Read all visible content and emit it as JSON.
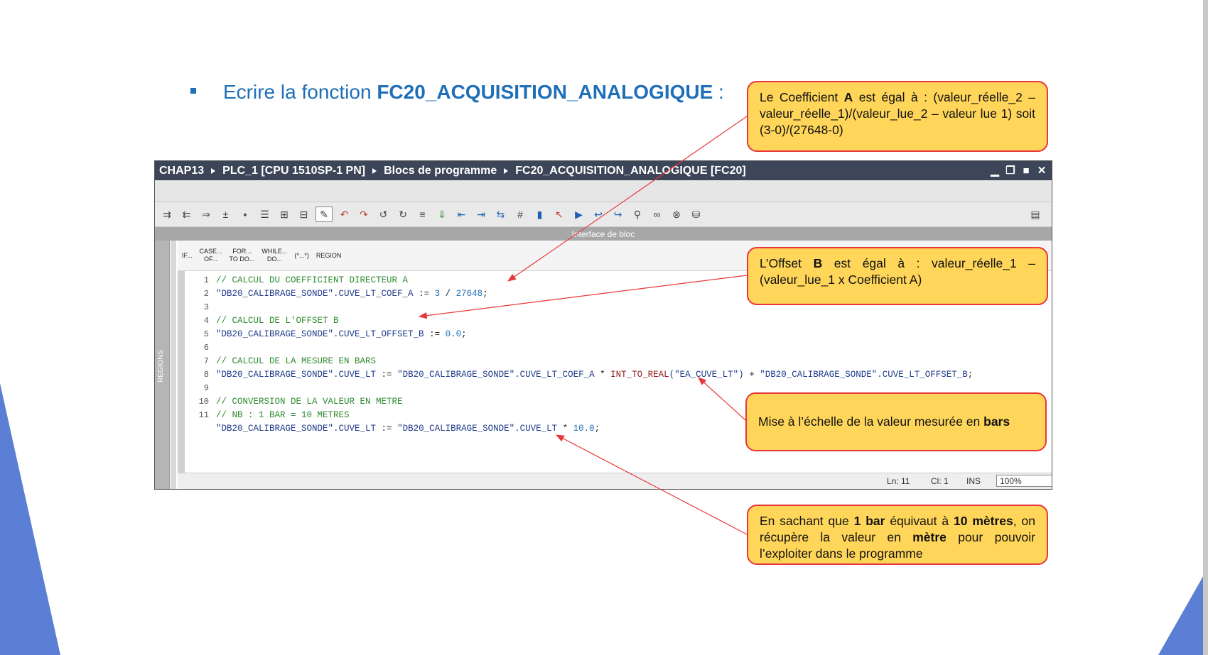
{
  "slide": {
    "title_prefix": "Ecrire la fonction ",
    "title_bold": "FC20_ACQUISITION_ANALOGIQUE",
    "title_suffix": " :"
  },
  "colors": {
    "title_blue": "#1f6fb8",
    "callout_fill": "#ffd65a",
    "callout_border": "#e8373a",
    "titlebar_bg": "#3c4658"
  },
  "window": {
    "breadcrumbs": [
      "CHAP13",
      "PLC_1 [CPU 1510SP-1 PN]",
      "Blocs de programme",
      "FC20_ACQUISITION_ANALOGIQUE [FC20]"
    ],
    "interface_bar": "Interface de bloc",
    "regions_label": "REGIONS",
    "toolbar_icons": [
      "insert-network-icon",
      "delete-network-icon",
      "jump-icon",
      "download-icon",
      "monitor-icon",
      "list-icon",
      "compare-icon",
      "reference-icon",
      "highlight-icon",
      "breakpoint-icon",
      "breakpoint-off-icon",
      "step-icon",
      "step-over-icon",
      "comment-icon",
      "expand-icon",
      "indent-left-icon",
      "indent-right-icon",
      "block-comment-icon",
      "grid-icon",
      "bookmark-icon",
      "bookmark-prev-icon",
      "bookmark-next-icon",
      "go-to-icon",
      "go-back-icon",
      "tag-icon",
      "glasses-icon",
      "glasses-off-icon",
      "db-icon"
    ]
  },
  "snippets": [
    {
      "line1": "IF...",
      "line2": ""
    },
    {
      "line1": "CASE...",
      "line2": "OF..."
    },
    {
      "line1": "FOR...",
      "line2": "TO DO..."
    },
    {
      "line1": "WHILE...",
      "line2": "DO..."
    },
    {
      "line1": "(*...*)",
      "line2": ""
    },
    {
      "line1": "REGION",
      "line2": ""
    }
  ],
  "code": {
    "l1_no": "1",
    "l1_comment": "// CALCUL DU COEFFICIENT DIRECTEUR A",
    "l2_no": "2",
    "l2_db": "\"DB20_CALIBRAGE_SONDE\"",
    "l2_member": ".CUVE_LT_COEF_A",
    "l2_op": " := ",
    "l2_num1": "3",
    "l2_div": " / ",
    "l2_num2": "27648",
    "l2_end": ";",
    "l3_no": "3",
    "l4_no": "4",
    "l4_comment": "// CALCUL DE L'OFFSET B",
    "l5_no": "5",
    "l5_db": "\"DB20_CALIBRAGE_SONDE\"",
    "l5_member": ".CUVE_LT_OFFSET_B",
    "l5_op": " := ",
    "l5_num": "0.0",
    "l5_end": ";",
    "l6_no": "6",
    "l7_no": "7",
    "l7_comment": "// CALCUL DE LA MESURE EN BARS",
    "l8_no": "8",
    "l8_db1": "\"DB20_CALIBRAGE_SONDE\"",
    "l8_m1": ".CUVE_LT",
    "l8_op1": " := ",
    "l8_db2": "\"DB20_CALIBRAGE_SONDE\"",
    "l8_m2": ".CUVE_LT_COEF_A",
    "l8_mul": " * ",
    "l8_fn": "INT_TO_REAL",
    "l8_arg": "(\"EA_CUVE_LT\")",
    "l8_plus": " + ",
    "l8_db3": "\"DB20_CALIBRAGE_SONDE\"",
    "l8_m3": ".CUVE_LT_OFFSET_B",
    "l8_end": ";",
    "l9_no": "9",
    "l10_no": "10",
    "l10_comment": "// CONVERSION DE LA VALEUR EN METRE",
    "l11_no": "11",
    "l11_comment": "// NB : 1 BAR = 10 METRES",
    "l12_db1": "\"DB20_CALIBRAGE_SONDE\"",
    "l12_m1": ".CUVE_LT",
    "l12_op": " := ",
    "l12_db2": "\"DB20_CALIBRAGE_SONDE\"",
    "l12_m2": ".CUVE_LT",
    "l12_mul": " * ",
    "l12_num": "10.0",
    "l12_end": ";"
  },
  "status": {
    "ln": "Ln: 11",
    "cl": "Cl: 1",
    "mode": "INS",
    "zoom": "100%"
  },
  "callouts": {
    "coef": {
      "t1": "Le Coefficient ",
      "b1": "A",
      "t2": " est égal à : (valeur_réelle_2 – valeur_réelle_1)/(valeur_lue_2 – valeur lue 1) soit (3-0)/(27648-0)"
    },
    "offset": {
      "t1": "L’Offset ",
      "b1": "B",
      "t2": " est égal à : valeur_réelle_1 – (valeur_lue_1 x Coefficient A)"
    },
    "scale": {
      "t1": "Mise à l’échelle de la valeur mesurée en ",
      "b1": "bars"
    },
    "meter": {
      "t1": "En sachant que ",
      "b1": "1 bar",
      "t2": " équivaut à ",
      "b2": "10 mètres",
      "t3": ", on récupère la valeur en ",
      "b3": "mètre",
      "t4": " pour pouvoir l’exploiter dans le programme"
    }
  }
}
